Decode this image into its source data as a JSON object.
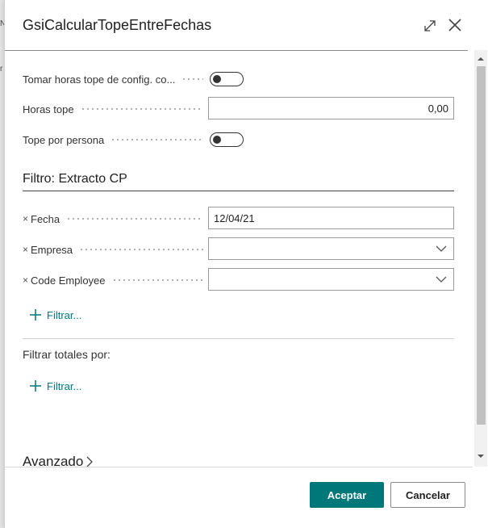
{
  "background": {
    "fragment_top": "N",
    "fragment_mid": "r"
  },
  "dialog": {
    "title": "GsiCalcularTopeEntreFechas",
    "expand_icon": "expand-diagonal-icon",
    "close_icon": "close-x-icon"
  },
  "fields": [
    {
      "label": "Tomar horas tope de config. co...",
      "type": "toggle",
      "value": false
    },
    {
      "label": "Horas tope",
      "type": "number",
      "value": "0,00"
    },
    {
      "label": "Tope por persona",
      "type": "toggle",
      "value": false
    }
  ],
  "filter_section": {
    "title": "Filtro: Extracto CP",
    "remove_mark": "×",
    "filters": [
      {
        "label": "Fecha",
        "value": "12/04/21",
        "type": "text"
      },
      {
        "label": "Empresa",
        "value": "",
        "type": "select"
      },
      {
        "label": "Code Employee",
        "value": "",
        "type": "select"
      }
    ],
    "add_filter_label": "Filtrar..."
  },
  "totals_section": {
    "label": "Filtrar totales por:",
    "add_filter_label": "Filtrar..."
  },
  "advanced": {
    "label": "Avanzado"
  },
  "buttons": {
    "ok": "Aceptar",
    "cancel": "Cancelar"
  },
  "colors": {
    "accent": "#00787a",
    "text": "#212121",
    "toggle_off": "#333333"
  }
}
